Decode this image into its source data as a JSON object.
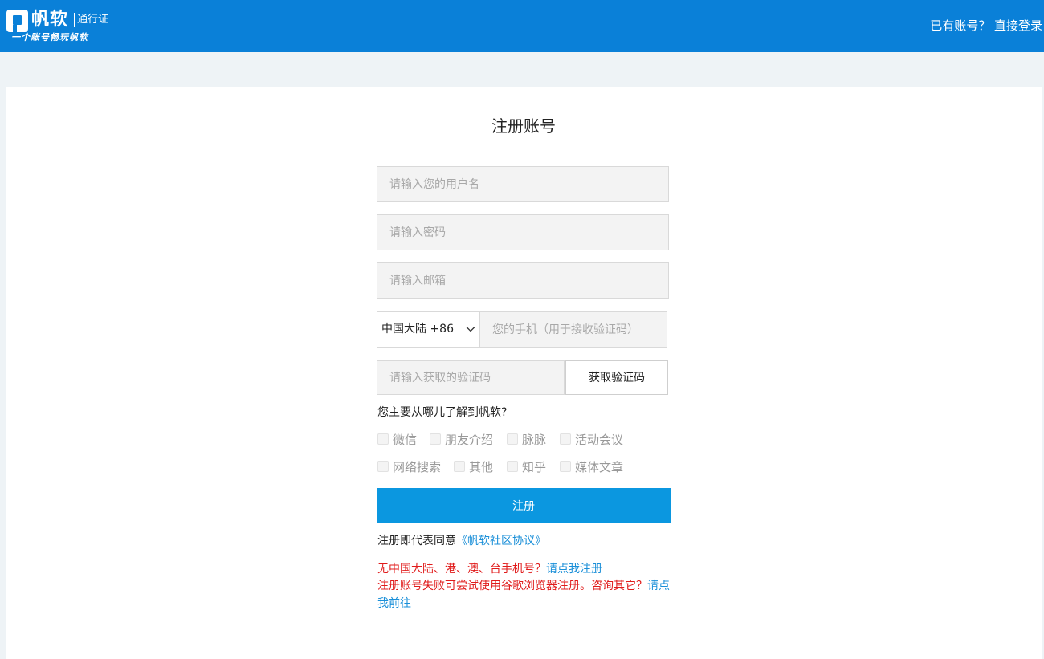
{
  "header": {
    "brand_name": "帆软",
    "brand_sub": "通行证",
    "slogan": "一个账号畅玩帆软",
    "login_prompt": "已有账号？",
    "login_link": "直接登录"
  },
  "form": {
    "title": "注册账号",
    "username_placeholder": "请输入您的用户名",
    "password_placeholder": "请输入密码",
    "email_placeholder": "请输入邮箱",
    "country_value": "中国大陆 +86",
    "phone_placeholder": "您的手机（用于接收验证码）",
    "code_placeholder": "请输入获取的验证码",
    "code_button": "获取验证码",
    "question": "您主要从哪儿了解到帆软?",
    "options": [
      "微信",
      "朋友介绍",
      "脉脉",
      "活动会议",
      "网络搜索",
      "其他",
      "知乎",
      "媒体文章"
    ],
    "submit": "注册",
    "agree_text": "注册即代表同意",
    "agree_link": "《帆软社区协议》"
  },
  "notices": {
    "line1_text": "无中国大陆、港、澳、台手机号？",
    "line1_link": "请点我注册",
    "line2_text": "注册账号失败可尝试使用谷歌浏览器注册。咨询其它？",
    "line2_link": "请点我前往"
  },
  "colors": {
    "header_bg": "#0a80d8",
    "primary_button": "#0b97e0",
    "link": "#1a8fd8",
    "notice_red": "#e01b1b"
  }
}
